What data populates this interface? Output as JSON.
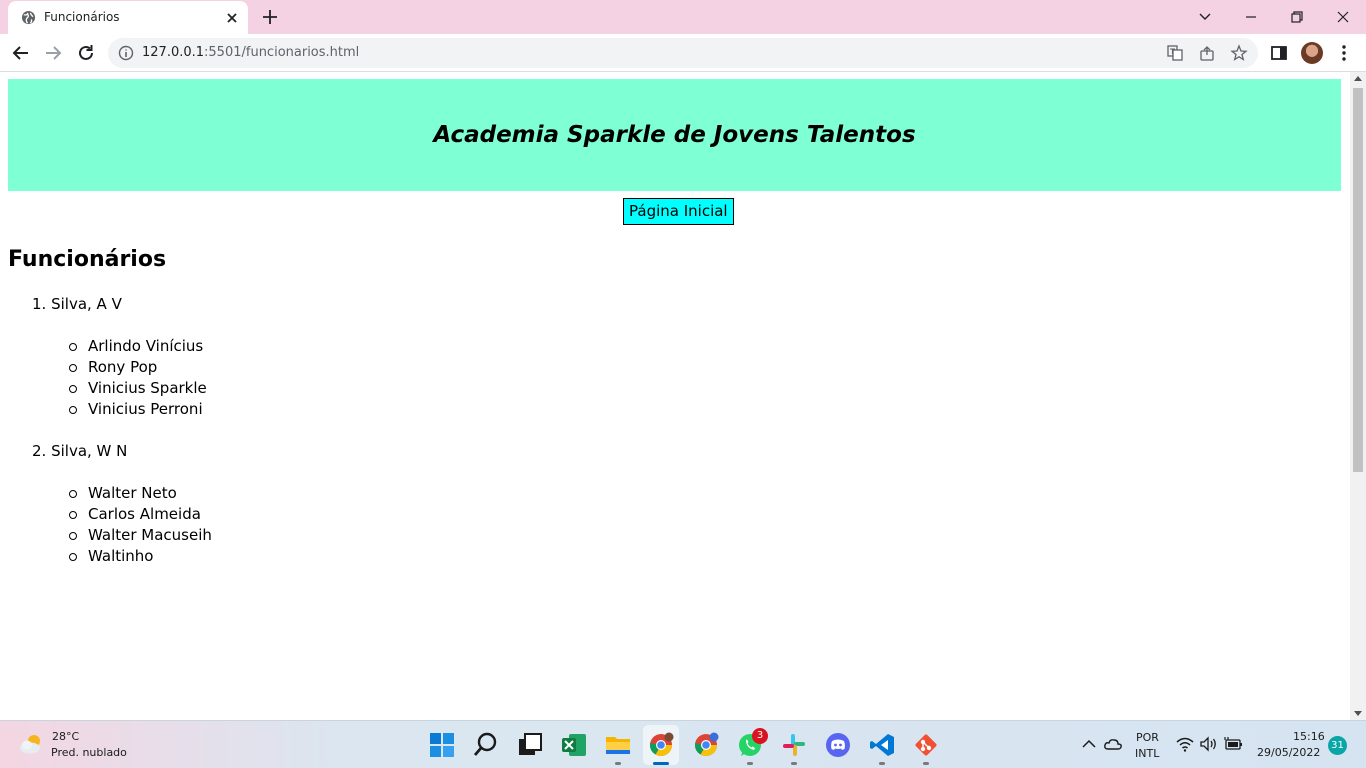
{
  "browser": {
    "tab_title": "Funcionários",
    "url_host": "127.0.0.1",
    "url_path": ":5501/funcionarios.html"
  },
  "page": {
    "header_title": "Academia Sparkle de Jovens Talentos",
    "home_button": "Página Inicial",
    "section_title": "Funcionários",
    "groups": [
      {
        "label": "Silva, A V",
        "members": [
          "Arlindo Vinícius",
          "Rony Pop",
          "Vinicius Sparkle",
          "Vinicius Perroni"
        ]
      },
      {
        "label": "Silva, W N",
        "members": [
          "Walter Neto",
          "Carlos Almeida",
          "Walter Macuseih",
          "Waltinho"
        ]
      }
    ],
    "colors": {
      "header_bg": "#7fffd4",
      "button_bg": "#00ffff"
    }
  },
  "taskbar": {
    "weather_temp": "28°C",
    "weather_desc": "Pred. nublado",
    "whatsapp_badge": "3",
    "lang_top": "POR",
    "lang_bottom": "INTL",
    "time": "15:16",
    "date": "29/05/2022",
    "notification_count": "31",
    "apps": [
      "start-icon",
      "search-icon",
      "task-view-icon",
      "excel-icon",
      "file-explorer-icon",
      "chrome-icon",
      "chrome-profile-icon",
      "whatsapp-icon",
      "slack-icon",
      "discord-icon",
      "vscode-icon",
      "git-icon"
    ]
  }
}
